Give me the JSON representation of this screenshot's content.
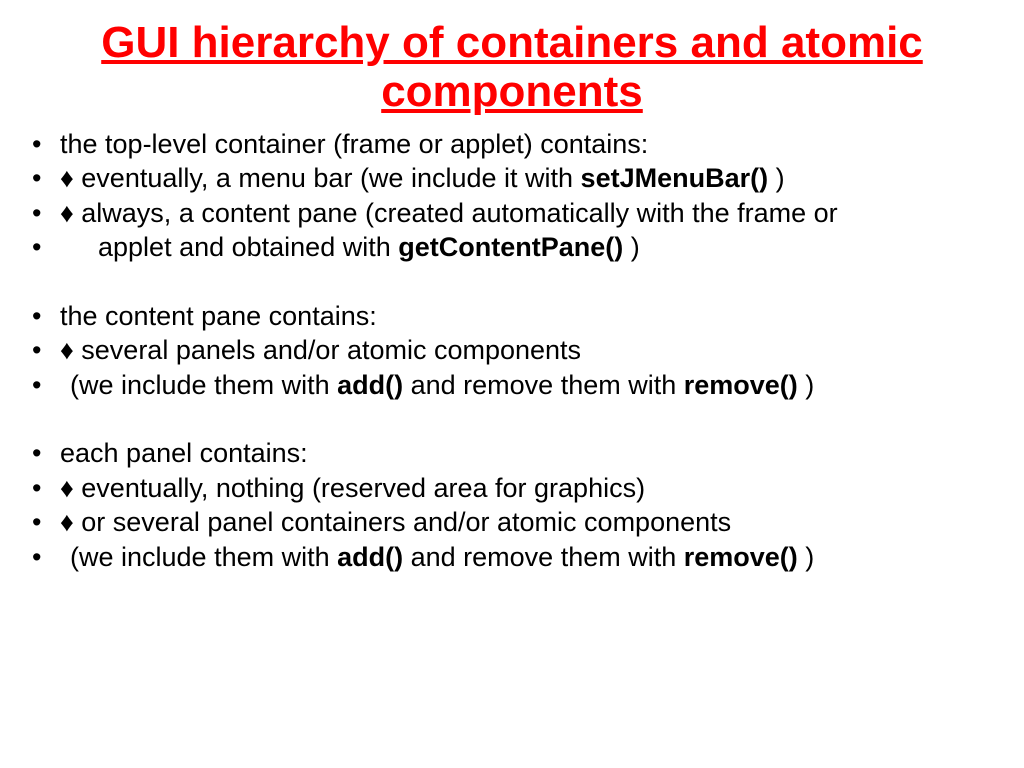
{
  "title": "GUI hierarchy of containers and atomic components",
  "bullets": {
    "diamond": "♦",
    "b1": "the top-level container (frame or applet) contains:",
    "b2_pre": " eventually, a menu bar  (we include it with ",
    "b2_bold": "setJMenuBar()",
    "b2_post": " )",
    "b3_pre": " always, a content pane  (created automatically with the frame or",
    "b4_pre": "applet and obtained with ",
    "b4_bold": "getContentPane()",
    "b4_post": " )",
    "b5": "the content pane contains:",
    "b6": " several panels and/or atomic components",
    "b7_pre": "(we include them with ",
    "b7_bold1": "add()",
    "b7_mid": " and remove them with ",
    "b7_bold2": "remove()",
    "b7_post": " )",
    "b8": "each panel contains:",
    "b9": " eventually, nothing (reserved area for graphics)",
    "b10": " or several panel containers and/or atomic components",
    "b11_pre": "(we include them with ",
    "b11_bold1": "add()",
    "b11_mid": " and remove them with ",
    "b11_bold2": "remove()",
    "b11_post": " )"
  }
}
